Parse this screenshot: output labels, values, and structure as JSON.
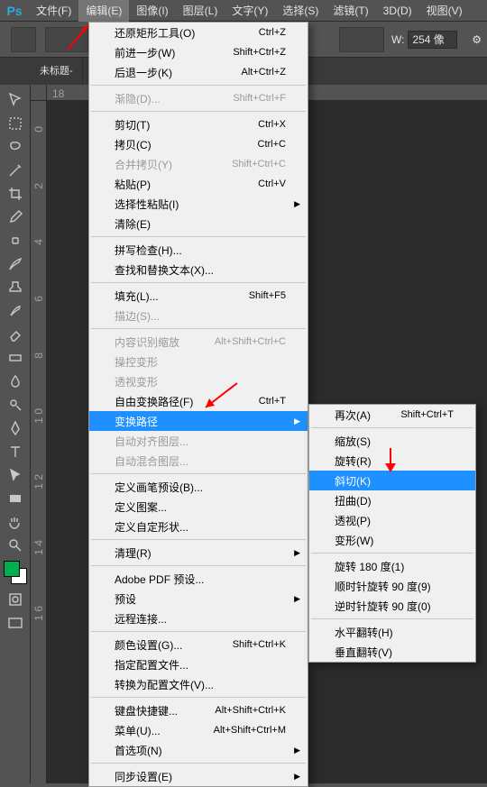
{
  "app": {
    "logo": "Ps"
  },
  "menu_bar": {
    "items": [
      "文件(F)",
      "编辑(E)",
      "图像(I)",
      "图层(L)",
      "文字(Y)",
      "选择(S)",
      "滤镜(T)",
      "3D(D)",
      "视图(V)"
    ],
    "active_index": 1
  },
  "options_bar": {
    "width_label": "W:",
    "width_value": "254 像"
  },
  "tabs": {
    "doc_title": "未标题-"
  },
  "ruler": {
    "h_marks": [
      "18"
    ],
    "v_marks": [
      "0",
      "2",
      "4",
      "6",
      "8",
      "1\n0",
      "1\n2",
      "1\n4",
      "1\n6"
    ]
  },
  "edit_menu": {
    "undo": {
      "label": "还原矩形工具(O)",
      "shortcut": "Ctrl+Z",
      "enabled": true
    },
    "step_forward": {
      "label": "前进一步(W)",
      "shortcut": "Shift+Ctrl+Z",
      "enabled": true
    },
    "step_back": {
      "label": "后退一步(K)",
      "shortcut": "Alt+Ctrl+Z",
      "enabled": true
    },
    "fade": {
      "label": "渐隐(D)...",
      "shortcut": "Shift+Ctrl+F",
      "enabled": false
    },
    "cut": {
      "label": "剪切(T)",
      "shortcut": "Ctrl+X",
      "enabled": true
    },
    "copy": {
      "label": "拷贝(C)",
      "shortcut": "Ctrl+C",
      "enabled": true
    },
    "copy_merged": {
      "label": "合并拷贝(Y)",
      "shortcut": "Shift+Ctrl+C",
      "enabled": false
    },
    "paste": {
      "label": "粘贴(P)",
      "shortcut": "Ctrl+V",
      "enabled": true
    },
    "paste_special": {
      "label": "选择性粘贴(I)",
      "shortcut": "",
      "enabled": true,
      "submenu": true
    },
    "clear": {
      "label": "清除(E)",
      "shortcut": "",
      "enabled": true
    },
    "spell": {
      "label": "拼写检查(H)...",
      "shortcut": "",
      "enabled": true
    },
    "find": {
      "label": "查找和替换文本(X)...",
      "shortcut": "",
      "enabled": true
    },
    "fill": {
      "label": "填充(L)...",
      "shortcut": "Shift+F5",
      "enabled": true
    },
    "stroke": {
      "label": "描边(S)...",
      "shortcut": "",
      "enabled": false
    },
    "content_aware": {
      "label": "内容识别缩放",
      "shortcut": "Alt+Shift+Ctrl+C",
      "enabled": false
    },
    "puppet": {
      "label": "操控变形",
      "shortcut": "",
      "enabled": false
    },
    "perspective": {
      "label": "透视变形",
      "shortcut": "",
      "enabled": false
    },
    "free_trans": {
      "label": "自由变换路径(F)",
      "shortcut": "Ctrl+T",
      "enabled": true
    },
    "transform": {
      "label": "变换路径",
      "shortcut": "",
      "enabled": true,
      "submenu": true,
      "highlighted": true
    },
    "auto_align": {
      "label": "自动对齐图层...",
      "shortcut": "",
      "enabled": false
    },
    "auto_blend": {
      "label": "自动混合图层...",
      "shortcut": "",
      "enabled": false
    },
    "define_brush": {
      "label": "定义画笔预设(B)...",
      "shortcut": "",
      "enabled": true
    },
    "define_pattern": {
      "label": "定义图案...",
      "shortcut": "",
      "enabled": true
    },
    "define_shape": {
      "label": "定义自定形状...",
      "shortcut": "",
      "enabled": true
    },
    "purge": {
      "label": "清理(R)",
      "shortcut": "",
      "enabled": true,
      "submenu": true
    },
    "adobe_pdf": {
      "label": "Adobe PDF 预设...",
      "shortcut": "",
      "enabled": true
    },
    "presets": {
      "label": "预设",
      "shortcut": "",
      "enabled": true,
      "submenu": true
    },
    "remote": {
      "label": "远程连接...",
      "shortcut": "",
      "enabled": true
    },
    "color_set": {
      "label": "颜色设置(G)...",
      "shortcut": "Shift+Ctrl+K",
      "enabled": true
    },
    "assign_prof": {
      "label": "指定配置文件...",
      "shortcut": "",
      "enabled": true
    },
    "convert_prof": {
      "label": "转换为配置文件(V)...",
      "shortcut": "",
      "enabled": true
    },
    "shortcuts": {
      "label": "键盘快捷键...",
      "shortcut": "Alt+Shift+Ctrl+K",
      "enabled": true
    },
    "menus": {
      "label": "菜单(U)...",
      "shortcut": "Alt+Shift+Ctrl+M",
      "enabled": true
    },
    "prefs": {
      "label": "首选项(N)",
      "shortcut": "",
      "enabled": true,
      "submenu": true
    },
    "sync": {
      "label": "同步设置(E)",
      "shortcut": "",
      "enabled": true,
      "submenu": true
    }
  },
  "transform_submenu": {
    "again": {
      "label": "再次(A)",
      "shortcut": "Shift+Ctrl+T",
      "enabled": true
    },
    "scale": {
      "label": "缩放(S)",
      "enabled": true
    },
    "rotate": {
      "label": "旋转(R)",
      "enabled": true
    },
    "skew": {
      "label": "斜切(K)",
      "enabled": true,
      "highlighted": true
    },
    "distort": {
      "label": "扭曲(D)",
      "enabled": true
    },
    "persp": {
      "label": "透视(P)",
      "enabled": true
    },
    "warp": {
      "label": "变形(W)",
      "enabled": true
    },
    "r180": {
      "label": "旋转 180 度(1)",
      "enabled": true
    },
    "r90cw": {
      "label": "顺时针旋转 90 度(9)",
      "enabled": true
    },
    "r90ccw": {
      "label": "逆时针旋转 90 度(0)",
      "enabled": true
    },
    "fliph": {
      "label": "水平翻转(H)",
      "enabled": true
    },
    "flipv": {
      "label": "垂直翻转(V)",
      "enabled": true
    }
  }
}
